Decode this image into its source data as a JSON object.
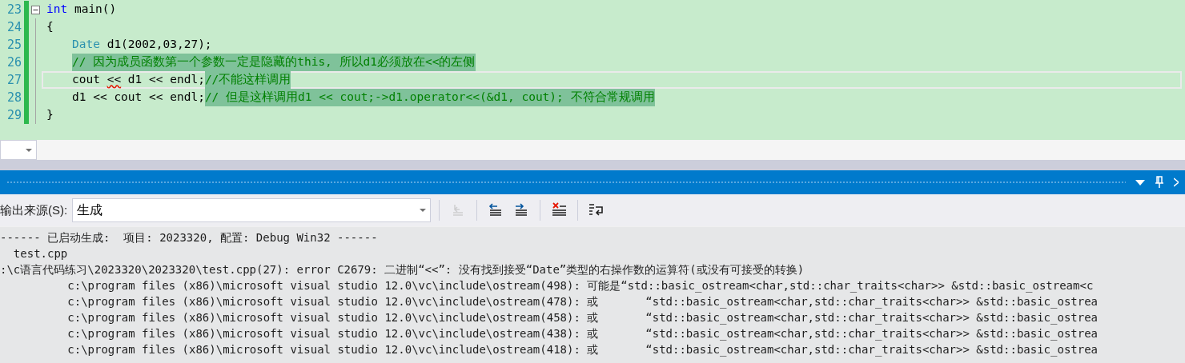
{
  "editor": {
    "lines": [
      {
        "number": "23",
        "fold": true,
        "current": false,
        "indent": false,
        "tokens": [
          {
            "kind": "keyword",
            "text": "int"
          },
          {
            "kind": "plain",
            "text": " main()"
          }
        ]
      },
      {
        "number": "24",
        "fold": false,
        "current": false,
        "indent": false,
        "tokens": [
          {
            "kind": "plain",
            "text": "{"
          }
        ]
      },
      {
        "number": "25",
        "fold": false,
        "current": false,
        "indent": true,
        "tokens": [
          {
            "kind": "type",
            "text": "Date"
          },
          {
            "kind": "plain",
            "text": " d1(2002,03,27);"
          }
        ]
      },
      {
        "number": "26",
        "fold": false,
        "current": false,
        "indent": true,
        "tokens": [
          {
            "kind": "comment",
            "text": "// 因为成员函数第一个参数一定是隐藏的this, 所以d1必须放在<<的左侧"
          }
        ]
      },
      {
        "number": "27",
        "fold": false,
        "current": true,
        "indent": true,
        "tokens": [
          {
            "kind": "plain",
            "text": "cout "
          },
          {
            "kind": "error",
            "text": "<<"
          },
          {
            "kind": "plain",
            "text": " d1 << endl;"
          },
          {
            "kind": "comment",
            "text": "//不能这样调用"
          }
        ]
      },
      {
        "number": "28",
        "fold": false,
        "current": false,
        "indent": true,
        "tokens": [
          {
            "kind": "plain",
            "text": "d1 << cout << endl;"
          },
          {
            "kind": "comment",
            "text": "// 但是这样调用d1 << cout;->d1.operator<<(&d1, cout); 不符合常规调用"
          }
        ]
      },
      {
        "number": "29",
        "fold": false,
        "current": false,
        "indent": false,
        "tokens": [
          {
            "kind": "plain",
            "text": "}"
          }
        ]
      }
    ]
  },
  "output_panel": {
    "toolbar": {
      "label": "输出来源(S):",
      "source": "生成",
      "buttons": [
        {
          "kind": "goto",
          "disabled": true
        },
        {
          "kind": "prev",
          "disabled": false
        },
        {
          "kind": "next",
          "disabled": false
        },
        {
          "kind": "clear",
          "disabled": false
        },
        {
          "kind": "wrap",
          "disabled": false
        }
      ]
    },
    "lines": [
      "------ 已启动生成:  项目: 2023320, 配置: Debug Win32 ------",
      "  test.cpp",
      ":\\c语言代码练习\\2023320\\2023320\\test.cpp(27): error C2679: 二进制“<<”: 没有找到接受“Date”类型的右操作数的运算符(或没有可接受的转换)",
      "          c:\\program files (x86)\\microsoft visual studio 12.0\\vc\\include\\ostream(498): 可能是“std::basic_ostream<char,std::char_traits<char>> &std::basic_ostream<c",
      "          c:\\program files (x86)\\microsoft visual studio 12.0\\vc\\include\\ostream(478): 或       “std::basic_ostream<char,std::char_traits<char>> &std::basic_ostrea",
      "          c:\\program files (x86)\\microsoft visual studio 12.0\\vc\\include\\ostream(458): 或       “std::basic_ostream<char,std::char_traits<char>> &std::basic_ostrea",
      "          c:\\program files (x86)\\microsoft visual studio 12.0\\vc\\include\\ostream(438): 或       “std::basic_ostream<char,std::char_traits<char>> &std::basic_ostrea",
      "          c:\\program files (x86)\\microsoft visual studio 12.0\\vc\\include\\ostream(418): 或       “std::basic_ostream<char,std::char_traits<char>> &std::basic_ostrea"
    ]
  }
}
